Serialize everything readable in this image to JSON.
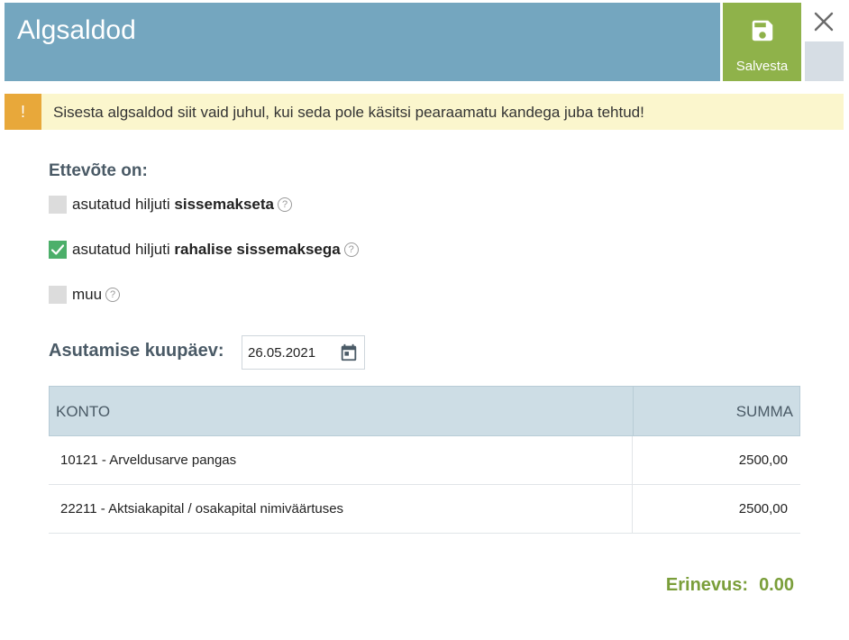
{
  "header": {
    "title": "Algsaldod",
    "save_label": "Salvesta"
  },
  "warning": {
    "icon": "!",
    "text": "Sisesta algsaldod siit vaid juhul, kui seda pole käsitsi pearaamatu kandega juba tehtud!"
  },
  "company": {
    "label": "Ettevõte on:",
    "options": [
      {
        "prefix": "asutatud hiljuti ",
        "bold": "sissemakseta",
        "checked": false
      },
      {
        "prefix": "asutatud hiljuti ",
        "bold": "rahalise sissemaksega",
        "checked": true
      },
      {
        "prefix": "muu",
        "bold": "",
        "checked": false
      }
    ]
  },
  "founding": {
    "label": "Asutamise kuupäev:",
    "date": "26.05.2021"
  },
  "table": {
    "col_account": "KONTO",
    "col_amount": "SUMMA",
    "rows": [
      {
        "account": "10121 - Arveldusarve pangas",
        "amount": "2500,00"
      },
      {
        "account": "22211 - Aktsiakapital / osakapital nimiväärtuses",
        "amount": "2500,00"
      }
    ]
  },
  "difference": {
    "label": "Erinevus:",
    "value": "0.00"
  },
  "colors": {
    "header_bg": "#74a6bf",
    "save_bg": "#8fb24a",
    "warning_bg": "#fbf6cd",
    "warning_icon_bg": "#e8a83a",
    "checked": "#4caf6a",
    "difference": "#7a9e3a"
  }
}
